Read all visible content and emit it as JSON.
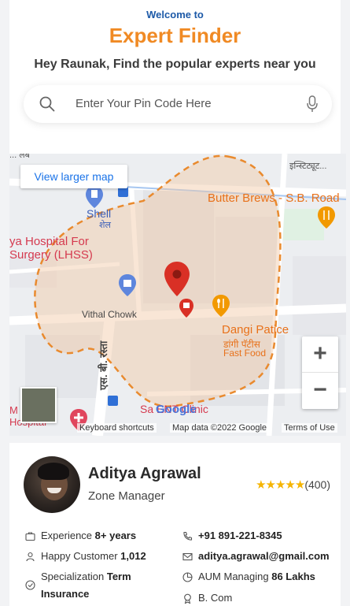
{
  "header": {
    "welcome": "Welcome to",
    "title": "Expert Finder",
    "subtitle": "Hey Raunak, Find the popular experts near you"
  },
  "search": {
    "placeholder": "Enter Your Pin Code Here",
    "search_icon": "search-icon",
    "mic_icon": "microphone-icon"
  },
  "map": {
    "view_larger": "View larger map",
    "zoom_in": "+",
    "zoom_out": "−",
    "labels": {
      "butter_brews": "Butter Brews - S.B. Road",
      "shell": "Shell",
      "shell_marathi": "शेल",
      "hospital_line1": "ya Hospital For",
      "hospital_line2": "Surgery (LHSS)",
      "vithal_chowk": "Vithal Chowk",
      "dangi_line1": "Dangi Patice",
      "dangi_line2": "डांगी पॅटीस",
      "dangi_line3": "Fast Food",
      "road_vertical": "एस. बी. रस्ता",
      "institute": "इन्स्टिट्यूट...",
      "ent_clinic": "Sa   ENT Clinic",
      "bottom_left1": "M   a",
      "bottom_left2": "Hospital",
      "top_left": "... लॅब"
    },
    "attribution": {
      "google": "Google",
      "shortcuts": "Keyboard shortcuts",
      "map_data": "Map data ©2022 Google",
      "terms": "Terms of Use"
    },
    "colors": {
      "boundary": "#e98a2e",
      "pin": "#d93025"
    }
  },
  "expert": {
    "name": "Aditya Agrawal",
    "role": "Zone Manager",
    "rating_stars": "★★★★★",
    "rating_count": "(400)",
    "experience_label": "Experience",
    "experience_value": "8+ years",
    "customers_label": "Happy Customer",
    "customers_value": "1,012",
    "specialization_label": "Specialization",
    "specialization_value_1": "Term",
    "specialization_value_2": "Insurance",
    "phone": "+91 891-221-8345",
    "email": "aditya.agrawal@gmail.com",
    "aum_label": "AUM Managing",
    "aum_value": "86 Lakhs",
    "education": "B. Com"
  }
}
